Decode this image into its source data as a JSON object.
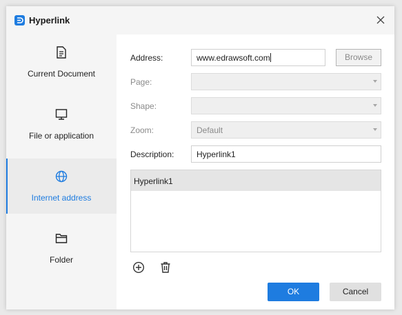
{
  "window": {
    "title": "Hyperlink",
    "app_icon": "edraw-app-icon",
    "close_icon": "close-icon"
  },
  "sidebar": {
    "items": [
      {
        "label": "Current Document",
        "icon": "document-icon",
        "active": false
      },
      {
        "label": "File or application",
        "icon": "monitor-icon",
        "active": false
      },
      {
        "label": "Internet address",
        "icon": "globe-icon",
        "active": true
      },
      {
        "label": "Folder",
        "icon": "folder-icon",
        "active": false
      }
    ]
  },
  "form": {
    "address": {
      "label": "Address:",
      "value": "www.edrawsoft.com"
    },
    "browse_label": "Browse",
    "page": {
      "label": "Page:",
      "value": ""
    },
    "shape": {
      "label": "Shape:",
      "value": ""
    },
    "zoom": {
      "label": "Zoom:",
      "value": "Default"
    },
    "description": {
      "label": "Description:",
      "value": "Hyperlink1"
    }
  },
  "hyperlinks": [
    "Hyperlink1"
  ],
  "toolbar": {
    "add_icon": "add-circle-icon",
    "delete_icon": "trash-icon"
  },
  "buttons": {
    "ok": "OK",
    "cancel": "Cancel"
  },
  "colors": {
    "accent": "#1e7ce0",
    "selected_row": "#e5e5e5",
    "sidebar_bg": "#f5f5f5"
  }
}
